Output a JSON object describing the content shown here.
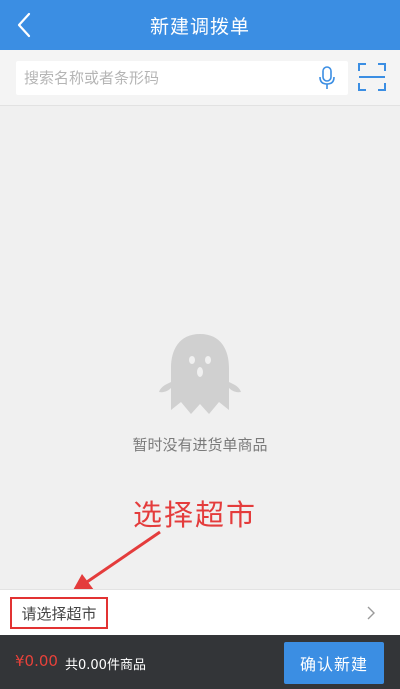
{
  "header": {
    "title": "新建调拨单",
    "back_icon": "back-chevron-icon"
  },
  "search": {
    "placeholder": "搜索名称或者条形码",
    "value": "",
    "mic_icon": "microphone-icon",
    "scan_icon": "scan-icon"
  },
  "empty_state": {
    "icon": "ghost-icon",
    "text": "暂时没有进货单商品"
  },
  "annotation": {
    "text": "选择超市",
    "color": "#e43c3c"
  },
  "store_select": {
    "label": "请选择超市",
    "chevron_icon": "chevron-right-icon"
  },
  "footer": {
    "price": "¥0.00",
    "count_text": "共0.00件商品",
    "confirm_label": "确认新建"
  },
  "colors": {
    "accent": "#3b8ee3",
    "footer_bg": "#333538",
    "price": "#e8413a"
  }
}
